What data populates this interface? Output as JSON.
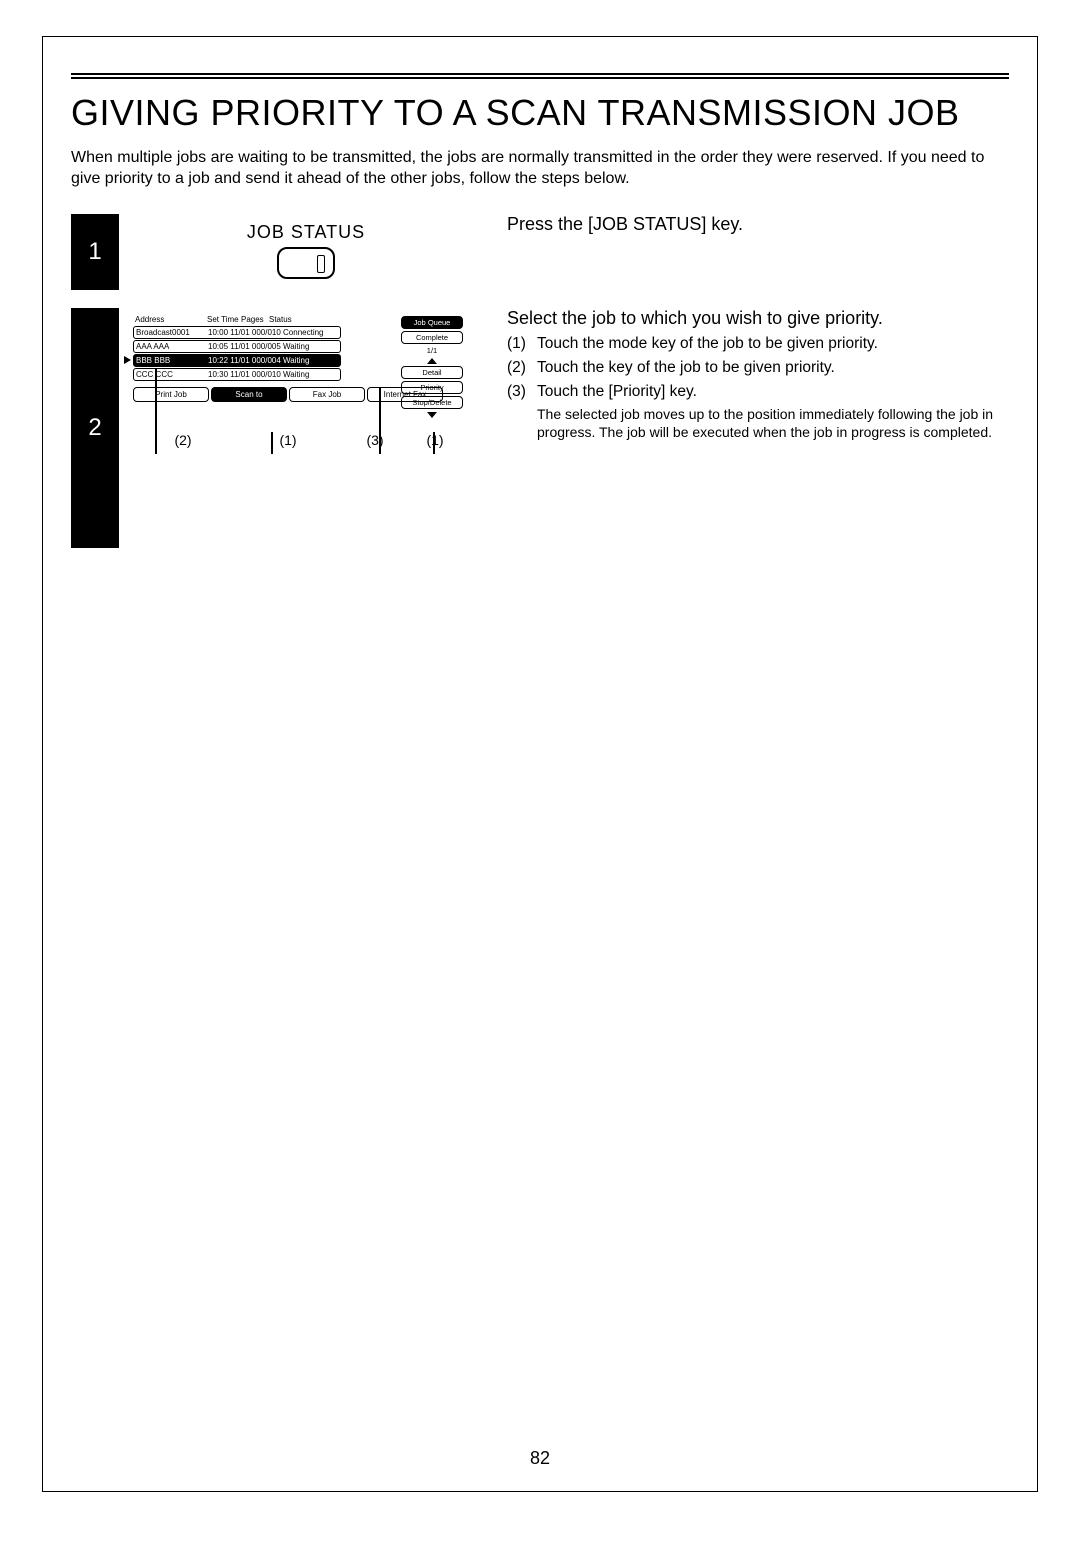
{
  "title": "GIVING PRIORITY TO A SCAN TRANSMISSION JOB",
  "intro": "When multiple jobs are waiting to be transmitted, the jobs are normally transmitted in the order they were reserved. If you need to give priority to a job and send it ahead of the other jobs, follow the steps below.",
  "page_number": "82",
  "step1": {
    "num": "1",
    "keycap": "JOB STATUS",
    "heading": "Press the [JOB STATUS] key."
  },
  "step2": {
    "num": "2",
    "heading": "Select the job to which you wish to give priority.",
    "sub1_num": "(1)",
    "sub1": "Touch the mode key of the job to be given priority.",
    "sub2_num": "(2)",
    "sub2": "Touch the key of the job to be given priority.",
    "sub3_num": "(3)",
    "sub3": "Touch the [Priority] key.",
    "note": "The selected job moves up to the position immediately following the job in progress. The job will be executed when the job in progress is completed.",
    "callout1": "(2)",
    "callout2": "(1)",
    "callout3": "(3)",
    "callout4": "(1)"
  },
  "screen": {
    "hdr_address": "Address",
    "hdr_settime": "Set Time",
    "hdr_pages": "Pages",
    "hdr_status": "Status",
    "rows": [
      {
        "addr": "Broadcast0001",
        "rest": "10:00 11/01 000/010 Connecting"
      },
      {
        "addr": "AAA AAA",
        "rest": "10:05 11/01 000/005 Waiting"
      },
      {
        "addr": "BBB BBB",
        "rest": "10:22 11/01 000/004 Waiting"
      },
      {
        "addr": "CCC CCC",
        "rest": "10:30 11/01 000/010 Waiting"
      }
    ],
    "frac": "1/1",
    "side_jobqueue": "Job Queue",
    "side_complete": "Complete",
    "side_detail": "Detail",
    "side_priority": "Priority",
    "side_stopdel": "Stop/Delete",
    "tab_print": "Print Job",
    "tab_scan": "Scan to",
    "tab_fax": "Fax Job",
    "tab_ifax": "Internet Fax"
  }
}
